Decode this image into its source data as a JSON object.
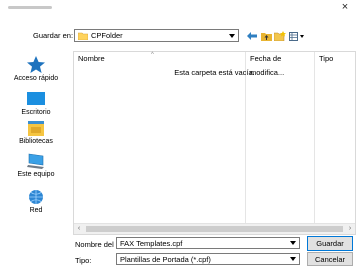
{
  "window": {
    "close_glyph": "×"
  },
  "location": {
    "label": "Guardar en:",
    "folder": "CPFolder",
    "toolbar_icons": [
      "back-icon",
      "up-folder-icon",
      "new-folder-icon",
      "view-menu-icon"
    ]
  },
  "places": [
    {
      "label": "Acceso rápido",
      "icon": "quick-access-star-icon"
    },
    {
      "label": "Escritorio",
      "icon": "desktop-icon"
    },
    {
      "label": "Bibliotecas",
      "icon": "libraries-icon"
    },
    {
      "label": "Este equipo",
      "icon": "this-pc-icon"
    },
    {
      "label": "Red",
      "icon": "network-icon"
    }
  ],
  "file_list": {
    "columns": [
      "Nombre",
      "Fecha de modifica...",
      "Tipo"
    ],
    "empty_message": "Esta carpeta está vacía."
  },
  "filename": {
    "label": "Nombre del",
    "value": "FAX Templates.cpf"
  },
  "filetype": {
    "label": "Tipo:",
    "value": "Plantillas de Portada (*.cpf)"
  },
  "buttons": {
    "save": "Guardar",
    "cancel": "Cancelar"
  },
  "colors": {
    "accent": "#0078d7",
    "folder": "#ffd35c",
    "star": "#1e73be"
  }
}
